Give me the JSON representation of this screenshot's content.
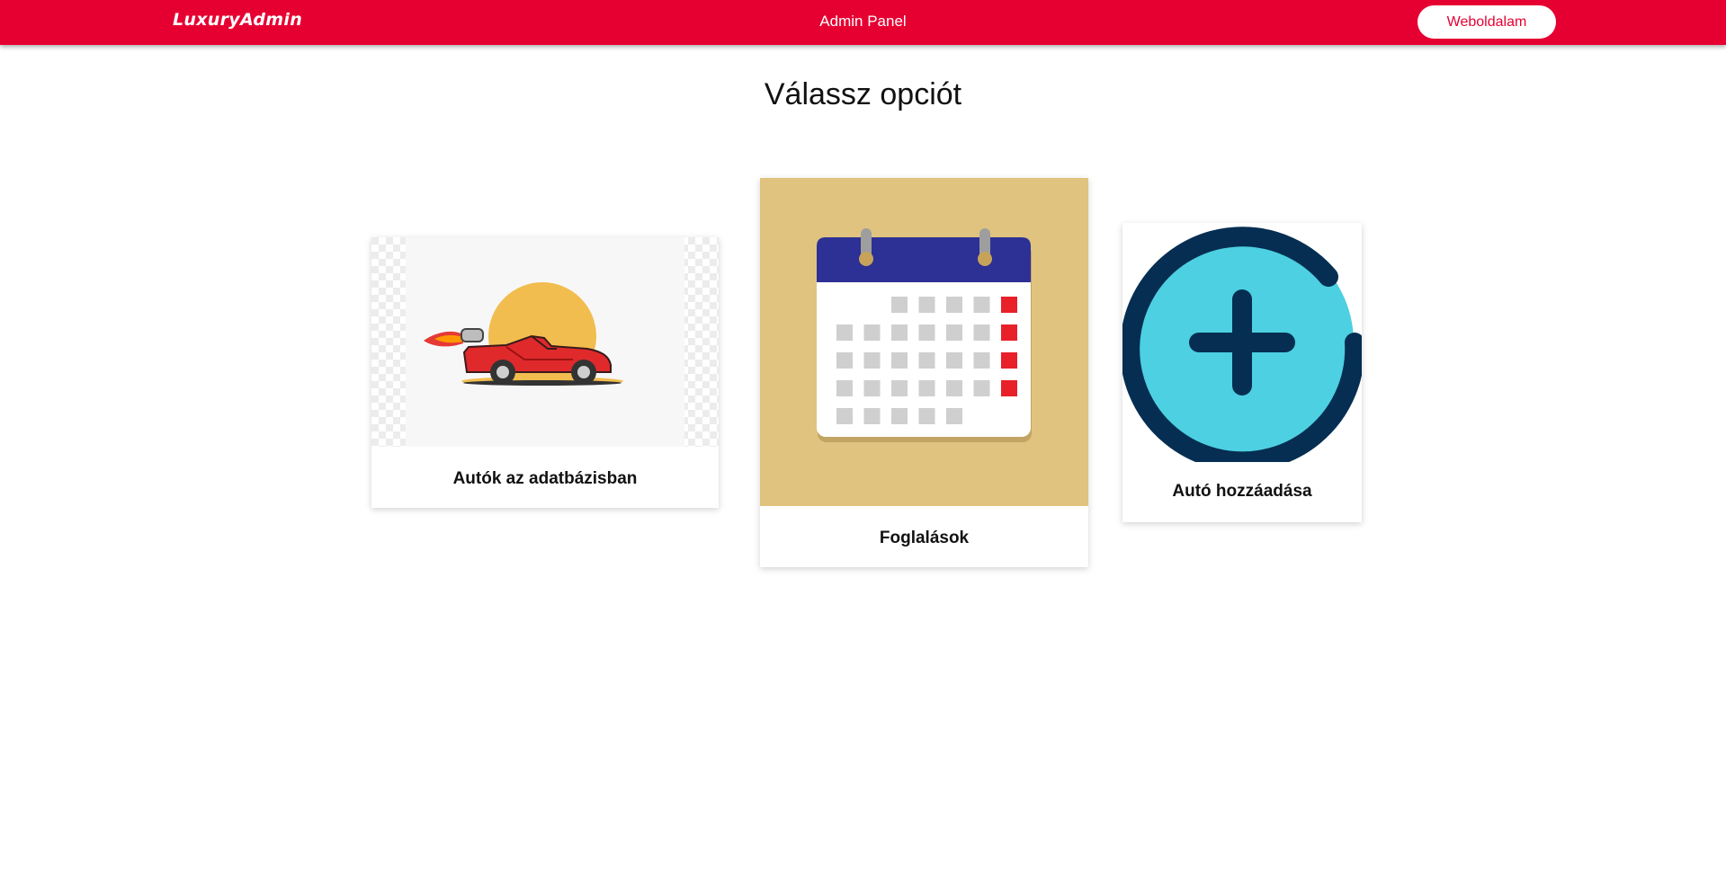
{
  "header": {
    "brand": "LuxuryAdmin",
    "title": "Admin Panel",
    "website_button": "Weboldalam"
  },
  "main": {
    "heading": "Válassz opciót",
    "cards": [
      {
        "label": "Autók az adatbázisban",
        "icon": "sports-car-icon"
      },
      {
        "label": "Foglalások",
        "icon": "calendar-icon"
      },
      {
        "label": "Autó hozzáadása",
        "icon": "add-circle-icon"
      }
    ]
  },
  "colors": {
    "accent": "#e60032",
    "calendar_background": "#e0c37e",
    "calendar_header": "#2d3094",
    "add_icon_fill": "#4dd0e1",
    "add_icon_stroke": "#052e52"
  }
}
